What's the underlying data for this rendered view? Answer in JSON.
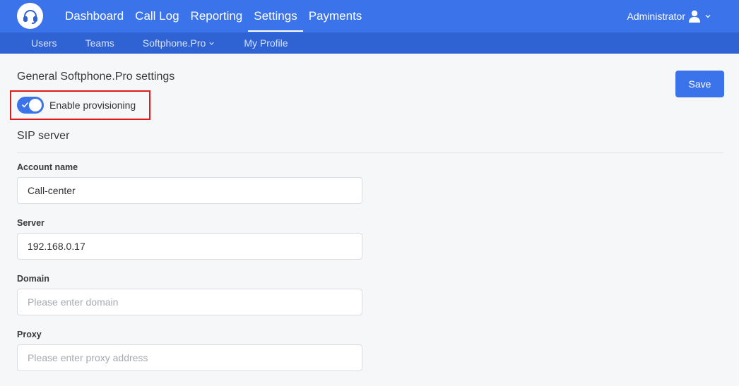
{
  "header": {
    "nav": [
      "Dashboard",
      "Call Log",
      "Reporting",
      "Settings",
      "Payments"
    ],
    "active_nav": "Settings",
    "user": "Administrator"
  },
  "subnav": {
    "items": [
      "Users",
      "Teams",
      "Softphone.Pro",
      "My Profile"
    ]
  },
  "main": {
    "title": "General Softphone.Pro settings",
    "save_label": "Save",
    "toggle_label": "Enable provisioning",
    "toggle_on": true,
    "section_title": "SIP server",
    "fields": [
      {
        "label": "Account name",
        "value": "Call-center",
        "placeholder": ""
      },
      {
        "label": "Server",
        "value": "192.168.0.17",
        "placeholder": ""
      },
      {
        "label": "Domain",
        "value": "",
        "placeholder": "Please enter domain"
      },
      {
        "label": "Proxy",
        "value": "",
        "placeholder": "Please enter proxy address"
      }
    ]
  },
  "colors": {
    "primary": "#3b73ea",
    "subnav": "#2f62d3",
    "highlight": "#e31b1b"
  },
  "icons": [
    "headset-logo-icon",
    "user-icon",
    "chevron-down-icon",
    "check-icon"
  ]
}
